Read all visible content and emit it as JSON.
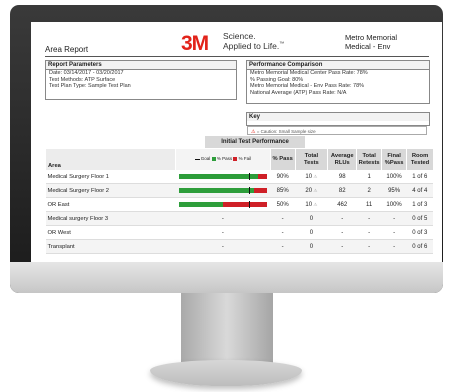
{
  "report": {
    "title": "Area Report",
    "brand_mark": "3M",
    "brand_tagline_1": "Science.",
    "brand_tagline_2": "Applied to Life.",
    "brand_tm": "™",
    "organization_1": "Metro Memorial",
    "organization_2": "Medical - Env"
  },
  "parameters": {
    "heading": "Report Parameters",
    "lines": [
      "Date: 03/14/2017 - 03/20/2017",
      "Test Methods: ATP Surface",
      "Test Plan Type: Sample Test Plan"
    ]
  },
  "comparison": {
    "heading": "Performance Comparison",
    "lines": [
      "Metro Memorial Medical Center Pass Rate: 78%",
      "% Passing Goal: 80%",
      "Metro Memorial Medical - Env Pass Rate: 78%",
      "National Average (ATP) Pass Rate: N/A"
    ]
  },
  "key": {
    "heading": "Key",
    "caution_icon": "warning-triangle",
    "caution_text": "= Caution: Small Sample size"
  },
  "table": {
    "group_header": "Initial Test Performance",
    "headers": {
      "area": "Area",
      "legend_goal": "Goal",
      "legend_pass": "% Pass",
      "legend_fail": "% Fail",
      "pass": "% Pass",
      "total_tests": "Total Tests",
      "avg_rlu": "Average RLUs",
      "total_retests": "Total Retests",
      "final_pass": "Final %Pass",
      "room_tested": "Room Tested"
    },
    "colors": {
      "pass": "#2e9e3b",
      "fail": "#cf2027",
      "goal": "#111111"
    },
    "rows": [
      {
        "area": "Medical Surgery Floor 1",
        "pass_pct": 0.9,
        "pass": "90%",
        "total_tests": "10",
        "caution": true,
        "avg_rlu": "98",
        "total_retests": "1",
        "final_pass": "100%",
        "room_tested": "1 of 6"
      },
      {
        "area": "Medical Surgery Floor 2",
        "pass_pct": 0.85,
        "pass": "85%",
        "total_tests": "20",
        "caution": true,
        "avg_rlu": "82",
        "total_retests": "2",
        "final_pass": "95%",
        "room_tested": "4 of 4"
      },
      {
        "area": "OR East",
        "pass_pct": 0.5,
        "pass": "50%",
        "total_tests": "10",
        "caution": true,
        "avg_rlu": "462",
        "total_retests": "11",
        "final_pass": "100%",
        "room_tested": "1 of 3"
      },
      {
        "area": "Medical surgery Floor 3",
        "bar": "-",
        "pass": "-",
        "total_tests": "0",
        "avg_rlu": "-",
        "total_retests": "-",
        "final_pass": "-",
        "room_tested": "0 of 5"
      },
      {
        "area": "OR West",
        "bar": "-",
        "pass": "-",
        "total_tests": "0",
        "avg_rlu": "-",
        "total_retests": "-",
        "final_pass": "-",
        "room_tested": "0 of 3"
      },
      {
        "area": "Transplant",
        "bar": "-",
        "pass": "-",
        "total_tests": "0",
        "avg_rlu": "-",
        "total_retests": "-",
        "final_pass": "-",
        "room_tested": "0 of 6"
      }
    ],
    "goal_pct": 0.8
  }
}
